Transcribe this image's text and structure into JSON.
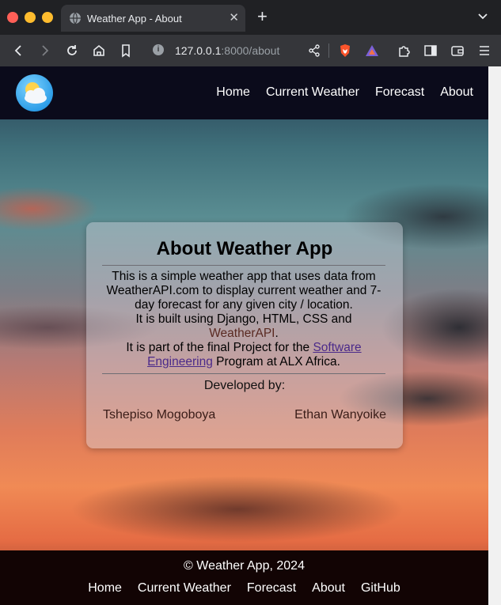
{
  "browser": {
    "tab_title": "Weather App - About",
    "url_host": "127.0.0.1",
    "url_rest": ":8000/about",
    "window_controls": {
      "close_color": "#ff5f57",
      "minimize_color": "#febc2e",
      "maximize_color": "#28c840"
    }
  },
  "nav": {
    "logo_icon": "weather-cloud-sun-icon",
    "links": [
      "Home",
      "Current Weather",
      "Forecast",
      "About"
    ]
  },
  "about": {
    "title": "About Weather App",
    "line1": "This is a simple weather app that uses data from WeatherAPI.com to display current weather and 7-day forecast for any given city / location.",
    "line2_prefix": "It is built using Django, HTML, CSS and ",
    "line2_api": "WeatherAPI",
    "line2_suffix": ".",
    "line3_prefix": "It is part of the final Project for the ",
    "line3_link": "Software Engineering",
    "line3_suffix": " Program at ALX Africa.",
    "developed_by": "Developed by:",
    "developers": [
      "Tshepiso Mogoboya",
      "Ethan Wanyoike"
    ]
  },
  "footer": {
    "copyright": "© Weather App, 2024",
    "links": [
      "Home",
      "Current Weather",
      "Forecast",
      "About",
      "GitHub"
    ]
  }
}
